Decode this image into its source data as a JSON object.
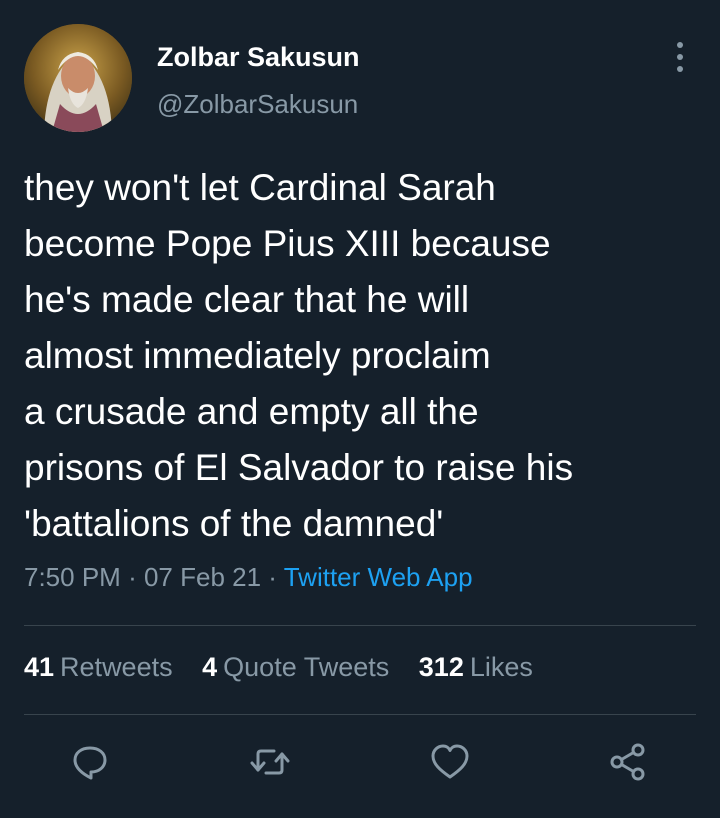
{
  "user": {
    "name": "Zolbar Sakusun",
    "handle": "@ZolbarSakusun"
  },
  "tweet": {
    "text": "they won't let Cardinal Sarah\nbecome Pope Pius XIII because\nhe's made clear that he will\nalmost immediately proclaim\na crusade and empty all the\nprisons of El Salvador to raise his\n'battalions of the damned'",
    "time": "7:50 PM",
    "separator": "·",
    "date": "07 Feb 21",
    "source": "Twitter Web App"
  },
  "stats": {
    "retweets_count": "41",
    "retweets_label": "Retweets",
    "quotes_count": "4",
    "quotes_label": "Quote Tweets",
    "likes_count": "312",
    "likes_label": "Likes"
  },
  "icons": {
    "more": "more-vertical-icon",
    "reply": "reply-icon",
    "retweet": "retweet-icon",
    "like": "heart-icon",
    "share": "share-icon"
  },
  "colors": {
    "background": "#15202b",
    "secondary_text": "#8899a6",
    "link": "#1da1f2",
    "divider": "#38444d"
  }
}
